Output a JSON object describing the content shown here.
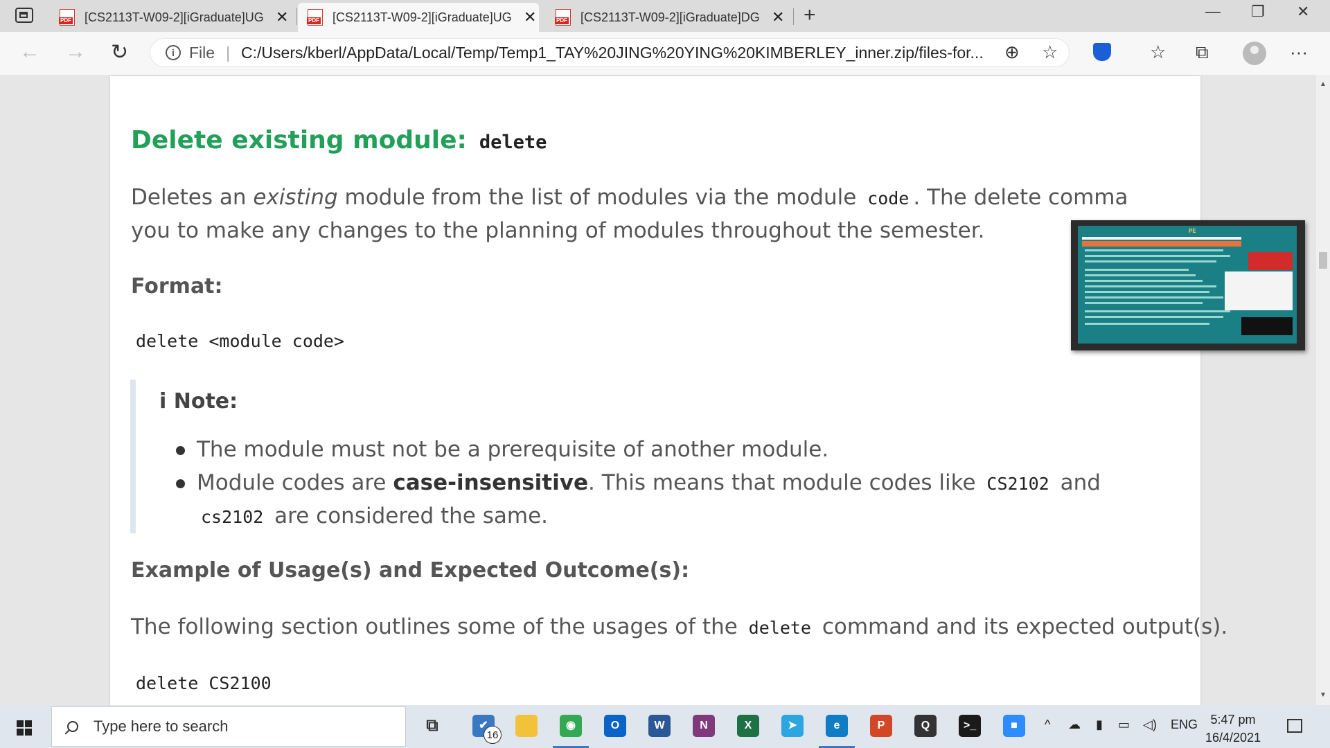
{
  "browser": {
    "tabs": [
      {
        "title": "[CS2113T-W09-2][iGraduate]UG",
        "active": false
      },
      {
        "title": "[CS2113T-W09-2][iGraduate]UG",
        "active": true
      },
      {
        "title": "[CS2113T-W09-2][iGraduate]DG",
        "active": false
      }
    ],
    "pdf_badge": "PDF",
    "close_glyph": "✕",
    "new_tab_glyph": "+",
    "window_buttons": {
      "minimize": "—",
      "restore": "❐",
      "close": "✕"
    },
    "address": {
      "scheme_label": "File",
      "separator": "|",
      "url": "C:/Users/kberl/AppData/Local/Temp/Temp1_TAY%20JING%20YING%20KIMBERLEY_inner.zip/files-for..."
    },
    "nav": {
      "back": "←",
      "forward": "→",
      "reload": "↻"
    },
    "toolbar_icons": {
      "zoom": "⊕",
      "favorite_add": "☆",
      "favorites": "☆",
      "collections": "⧉",
      "more": "···"
    }
  },
  "document": {
    "heading": "Delete existing module:",
    "heading_code": "delete",
    "intro_line1_a": "Deletes an",
    "intro_line1_em": "existing",
    "intro_line1_b": "module from the list of modules via the module",
    "intro_line1_code": "code",
    "intro_line1_c": ". The delete comma",
    "intro_line2": "you to make any changes to the planning of modules throughout the semester.",
    "format_heading": "Format:",
    "format_code": "delete <module code>",
    "note_title": "i Note:",
    "note_bullet1": "The module must not be a prerequisite of another module.",
    "note_bullet2_a": "Module codes are",
    "note_bullet2_b": "case-insensitive",
    "note_bullet2_c": ". This means that module codes like",
    "note_bullet2_code1": "CS2102",
    "note_bullet2_d": "and",
    "note_bullet2_code2": "cs2102",
    "note_bullet2_e": "are considered the same.",
    "example_heading": "Example of Usage(s) and Expected Outcome(s):",
    "example_para_a": "The following section outlines some of the usages of the",
    "example_para_code": "delete",
    "example_para_b": "command and its expected output(s).",
    "example_code": "delete CS2100"
  },
  "thumbnail": {
    "title": "PE"
  },
  "taskbar": {
    "search_placeholder": "Type here to search",
    "todo_badge": "16",
    "language": "ENG",
    "time": "5:47 pm",
    "date": "16/4/2021",
    "apps": [
      {
        "name": "task-view-icon",
        "label": "⧉",
        "color": "#dfe6ee"
      },
      {
        "name": "todo-icon",
        "label": "✔",
        "color": "#3b78c2"
      },
      {
        "name": "file-explorer-icon",
        "label": "",
        "color": "#f2c23a"
      },
      {
        "name": "chrome-icon",
        "label": "◉",
        "color": "#34a853"
      },
      {
        "name": "outlook-icon",
        "label": "O",
        "color": "#0a64c8"
      },
      {
        "name": "word-icon",
        "label": "W",
        "color": "#2b5797"
      },
      {
        "name": "onenote-icon",
        "label": "N",
        "color": "#80397b"
      },
      {
        "name": "excel-icon",
        "label": "X",
        "color": "#1e7145"
      },
      {
        "name": "telegram-icon",
        "label": "➤",
        "color": "#2ca5e0"
      },
      {
        "name": "edge-icon",
        "label": "e",
        "color": "#0f7cc4"
      },
      {
        "name": "powerpoint-icon",
        "label": "P",
        "color": "#d24726"
      },
      {
        "name": "search-app-icon",
        "label": "Q",
        "color": "#333333"
      },
      {
        "name": "terminal-icon",
        "label": ">_",
        "color": "#1a1a1a"
      },
      {
        "name": "zoom-icon",
        "label": "■",
        "color": "#2d8cff"
      }
    ]
  }
}
